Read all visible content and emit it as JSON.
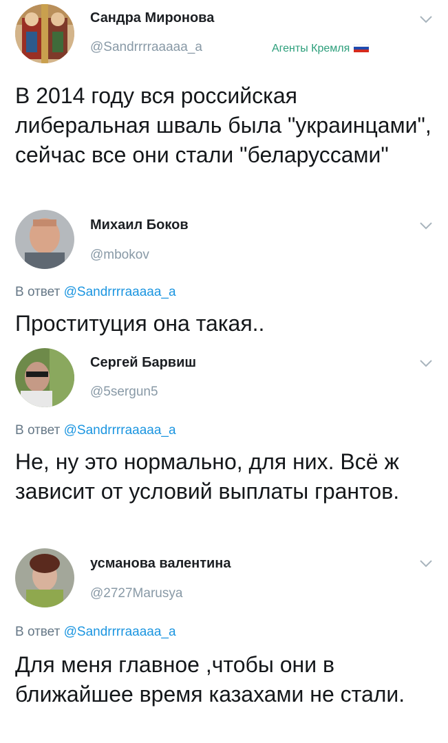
{
  "tweets": [
    {
      "name": "Сандра Миронова",
      "handle": "@Sandrrrraaaaa_a",
      "label": "Агенты Кремля",
      "text": "В 2014 году вся российская либеральная шваль была \"украинцами\", сейчас все они стали \"беларуссами\""
    },
    {
      "name": "Михаил Боков",
      "handle": "@mbokov",
      "reply_prefix": "В ответ",
      "reply_to": "@Sandrrrraaaaa_a",
      "text": "Проституция она такая.."
    },
    {
      "name": "Сергей  Барвиш",
      "handle": "@5sergun5",
      "reply_prefix": "В ответ",
      "reply_to": "@Sandrrrraaaaa_a",
      "text": "Не, ну это нормально, для них. Всё ж зависит от условий выплаты грантов."
    },
    {
      "name": "усманова валентина",
      "handle": "@2727Marusya",
      "reply_prefix": "В ответ",
      "reply_to": "@Sandrrrraaaaa_a",
      "text": "Для меня главное ,чтобы они в ближайшее время казахами не стали."
    }
  ],
  "icons": {
    "chevron": "chevron-down-icon",
    "flag": "russian-flag-icon"
  },
  "colors": {
    "handle": "#8899a6",
    "mention": "#1b95e0",
    "label": "#2b9e7a"
  }
}
